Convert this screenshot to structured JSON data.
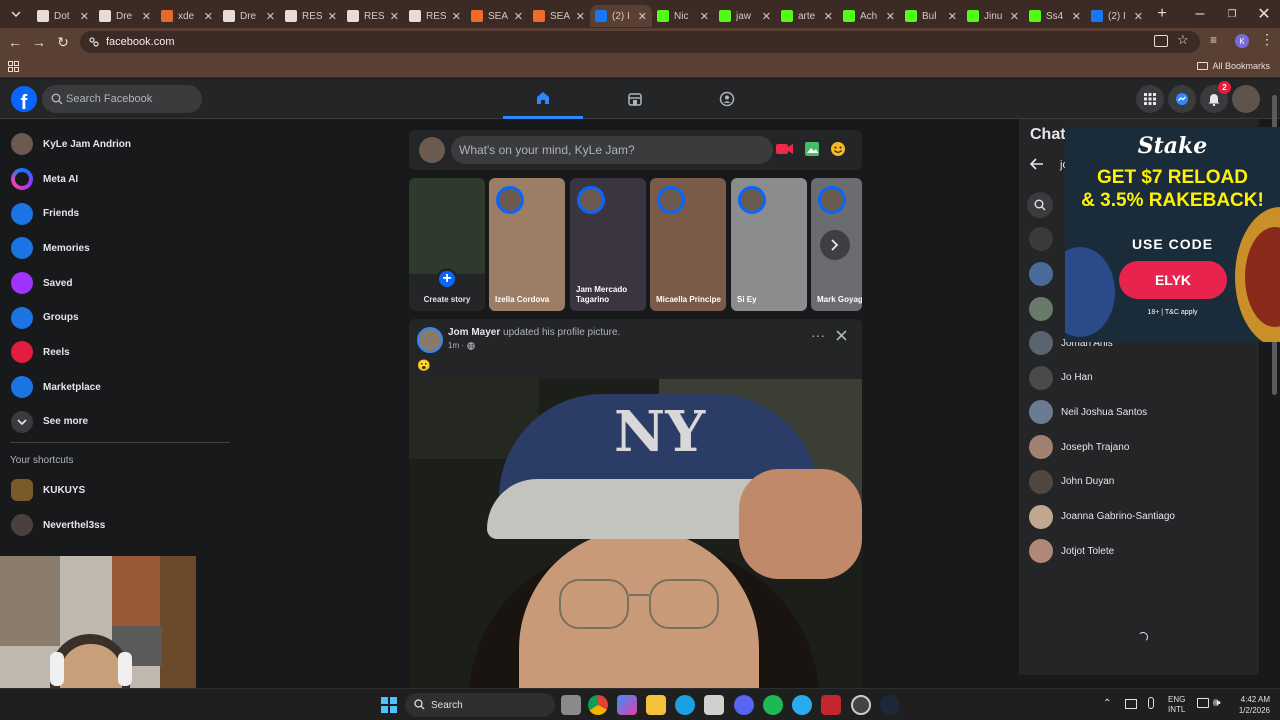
{
  "browser": {
    "tabs": [
      {
        "label": "Dot",
        "fav": "#e8dcd7"
      },
      {
        "label": "Dre",
        "fav": "#e8dcd7"
      },
      {
        "label": "xde",
        "fav": "#e46a2a"
      },
      {
        "label": "Dre",
        "fav": "#e8dcd7"
      },
      {
        "label": "RES",
        "fav": "#e8dcd7"
      },
      {
        "label": "RES",
        "fav": "#e8dcd7"
      },
      {
        "label": "RES",
        "fav": "#e8dcd7"
      },
      {
        "label": "SEA",
        "fav": "#f26b2a"
      },
      {
        "label": "SEA",
        "fav": "#f26b2a"
      },
      {
        "label": "(2) I",
        "fav": "#1877f2",
        "active": true
      },
      {
        "label": "Nic",
        "fav": "#53fc18"
      },
      {
        "label": "jaw",
        "fav": "#53fc18"
      },
      {
        "label": "arte",
        "fav": "#53fc18"
      },
      {
        "label": "Ach",
        "fav": "#53fc18"
      },
      {
        "label": "Bul",
        "fav": "#53fc18"
      },
      {
        "label": "Jinu",
        "fav": "#53fc18"
      },
      {
        "label": "Ss4",
        "fav": "#53fc18"
      },
      {
        "label": "(2) I",
        "fav": "#1877f2"
      }
    ],
    "url": "facebook.com",
    "all_bookmarks": "All Bookmarks"
  },
  "header": {
    "search_placeholder": "Search Facebook",
    "notification_count": "2"
  },
  "sidebar": {
    "items": [
      {
        "label": "KyLe Jam Andrion",
        "icon": "avatar",
        "color": "#6b5a50"
      },
      {
        "label": "Meta AI",
        "icon": "meta-ai-icon",
        "color": "#7b3fe4"
      },
      {
        "label": "Friends",
        "icon": "friends-icon",
        "color": "#1b74e4"
      },
      {
        "label": "Memories",
        "icon": "memories-icon",
        "color": "#1b74e4"
      },
      {
        "label": "Saved",
        "icon": "saved-icon",
        "color": "#a033ff"
      },
      {
        "label": "Groups",
        "icon": "groups-icon",
        "color": "#1b74e4"
      },
      {
        "label": "Reels",
        "icon": "reels-icon",
        "color": "#e41e3f"
      },
      {
        "label": "Marketplace",
        "icon": "marketplace-icon",
        "color": "#1b74e4"
      },
      {
        "label": "See more",
        "icon": "chevron-down-icon",
        "color": "#3a3b3c"
      }
    ],
    "shortcuts_title": "Your shortcuts",
    "shortcuts": [
      {
        "label": "KUKUYS"
      },
      {
        "label": "Neverthel3ss"
      }
    ]
  },
  "composer": {
    "placeholder": "What's on your mind, KyLe Jam?"
  },
  "stories": [
    {
      "name": "Create story",
      "bg": "#2e3b2c"
    },
    {
      "name": "Izella Cordova",
      "bg": "#9c7e66"
    },
    {
      "name": "Jam Mercado Tagarino",
      "bg": "#3a3540"
    },
    {
      "name": "Micaella Principe",
      "bg": "#7a5a48"
    },
    {
      "name": "Si Ey",
      "bg": "#8a8c8e"
    },
    {
      "name": "Mark Goyag",
      "bg": "#6a6c70"
    }
  ],
  "post": {
    "author": "Jom Mayer",
    "action": " updated his profile picture.",
    "time": "1m ·",
    "emoji": "😮"
  },
  "chat": {
    "title": "Chat",
    "search_fragment": "jo",
    "contacts": [
      {
        "name": "Joman Anis",
        "color": "#5a6470"
      },
      {
        "name": "Jo Han",
        "color": "#4a4a4a"
      },
      {
        "name": "Neil Joshua Santos",
        "color": "#6a7a90"
      },
      {
        "name": "Joseph Trajano",
        "color": "#a08070"
      },
      {
        "name": "John Duyan",
        "color": "#504840"
      },
      {
        "name": "Joanna Gabrino-Santiago",
        "color": "#c0a890"
      },
      {
        "name": "Jotjot Tolete",
        "color": "#b08878"
      }
    ]
  },
  "ad": {
    "brand": "Stake",
    "headline1": "GET $7 RELOAD",
    "headline2": "& 3.5% RAKEBACK!",
    "use_code": "USE CODE",
    "code": "ELYK",
    "disclaimer": "18+ | T&C apply"
  },
  "taskbar": {
    "search": "Search",
    "lang1": "ENG",
    "lang2": "INTL",
    "time": "4:42 AM",
    "date": "1/2/2026"
  }
}
